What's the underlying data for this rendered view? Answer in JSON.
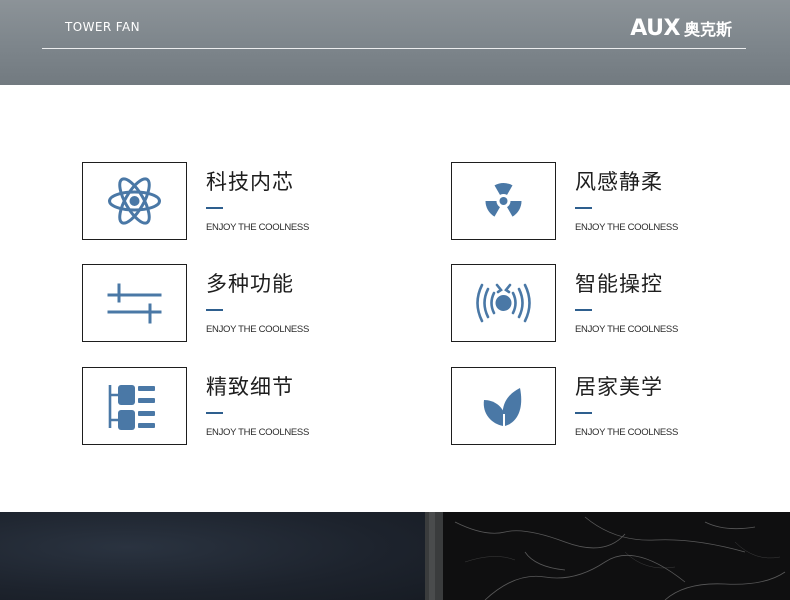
{
  "header": {
    "title": "TOWER FAN",
    "brand_latin": "AUX",
    "brand_cjk": "奥克斯"
  },
  "features": [
    {
      "title": "科技内芯",
      "subtitle": "ENJOY THE COOLNESS",
      "icon": "atom-icon"
    },
    {
      "title": "风感静柔",
      "subtitle": "ENJOY THE COOLNESS",
      "icon": "fan-blade-icon"
    },
    {
      "title": "多种功能",
      "subtitle": "ENJOY THE COOLNESS",
      "icon": "sliders-icon"
    },
    {
      "title": "智能操控",
      "subtitle": "ENJOY THE COOLNESS",
      "icon": "remote-signal-icon"
    },
    {
      "title": "精致细节",
      "subtitle": "ENJOY THE COOLNESS",
      "icon": "hierarchy-icon"
    },
    {
      "title": "居家美学",
      "subtitle": "ENJOY THE COOLNESS",
      "icon": "leaf-icon"
    }
  ],
  "colors": {
    "icon_blue": "#4a78a6",
    "dash_blue": "#2e5f8e",
    "header_gray": "#7d858b"
  }
}
